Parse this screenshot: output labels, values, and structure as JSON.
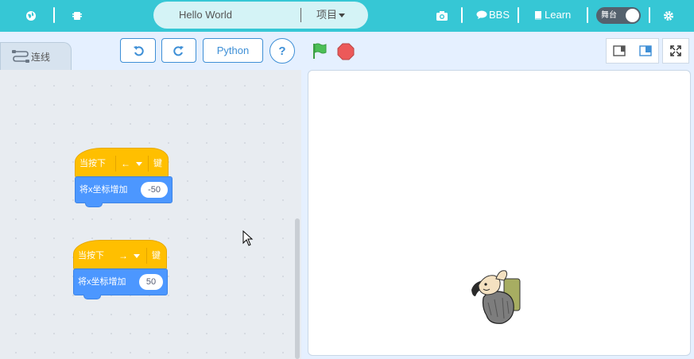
{
  "topbar": {
    "project_name": "Hello World",
    "project_menu": "项目",
    "bbs_label": "BBS",
    "learn_label": "Learn",
    "stage_toggle_label": "舞台",
    "icons": [
      "globe-icon",
      "chip-icon",
      "camera-icon",
      "chat-icon",
      "book-icon",
      "gear-icon"
    ]
  },
  "editor": {
    "tab_label": "连线",
    "python_label": "Python",
    "help_label": "?"
  },
  "scripts": [
    {
      "hat_prefix": "当按下",
      "key": "←",
      "hat_suffix": "键",
      "action_label": "将x坐标增加",
      "value": "-50"
    },
    {
      "hat_prefix": "当按下",
      "key": "→",
      "hat_suffix": "键",
      "action_label": "将x坐标增加",
      "value": "50"
    }
  ],
  "colors": {
    "topbar": "#36c7d5",
    "event_block": "#ffbf00",
    "motion_block": "#4c97ff",
    "accent": "#3e8fd6",
    "flag": "#4cbf56",
    "stop": "#ec5959"
  }
}
